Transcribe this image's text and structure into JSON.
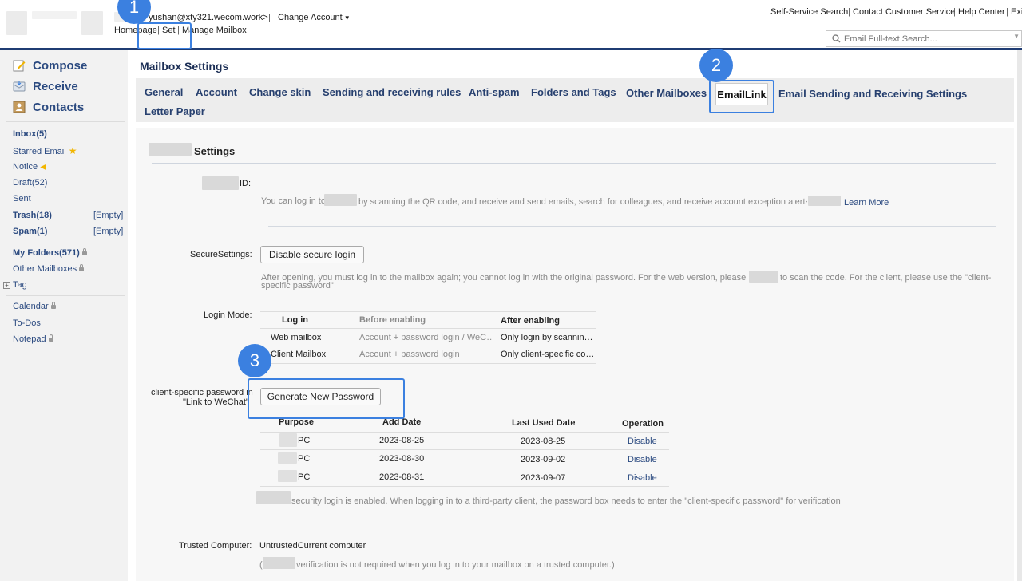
{
  "header": {
    "email": "yushan@xty321.wecom.work>",
    "change_account": "Change Account",
    "nav": [
      "Homepage",
      "Set",
      "Manage Mailbox"
    ],
    "top_links": [
      "Self-Service Search",
      "Contact Customer Service",
      "Help Center",
      "Exi"
    ],
    "search_placeholder": "Email Full-text Search..."
  },
  "sidebar": {
    "compose": "Compose",
    "receive": "Receive",
    "contacts": "Contacts",
    "inbox": "Inbox(5)",
    "starred": "Starred Email",
    "notice": "Notice",
    "draft": "Draft(52)",
    "sent": "Sent",
    "trash": "Trash(18)",
    "spam": "Spam(1)",
    "empty": "[Empty]",
    "my_folders": "My Folders(571)",
    "other_mailboxes": "Other Mailboxes",
    "tag": "Tag",
    "calendar": "Calendar",
    "todos": "To-Dos",
    "notepad": "Notepad"
  },
  "page_title": "Mailbox Settings",
  "tabs": [
    "General",
    "Account",
    "Change skin",
    "Sending and receiving rules",
    "Anti-spam",
    "Folders and Tags",
    "Other Mailboxes",
    "EmailLink",
    "Email Sending and Receiving Settings",
    "Letter Paper"
  ],
  "settings": {
    "section_title": "Settings",
    "id_label": "ID:",
    "id_desc_a": "You can log in to",
    "id_desc_b": "by scanning the QR code, and receive and send emails, search for colleagues, and receive account exception alerts on",
    "learn_more": "Learn More",
    "secure_label": "SecureSettings:",
    "disable_secure_btn": "Disable secure login",
    "secure_desc_a": "After opening, you must log in to the mailbox again; you cannot log in with the original password. For the web version, please use",
    "secure_desc_b": "to scan the code. For the client, please use the \"client-",
    "secure_desc_c": "specific password\"",
    "login_mode_label": "Login Mode:",
    "login_table": {
      "headers": [
        "Log in",
        "Before enabling",
        "After enabling"
      ],
      "rows": [
        [
          "Web mailbox",
          "Account + password login / WeC…",
          "Only login by scannin…"
        ],
        [
          "Client Mailbox",
          "Account + password login",
          "Only client-specific co…"
        ]
      ]
    },
    "csp_label_a": "client-specific password in",
    "csp_label_b": "\"Link to WeChat\"",
    "generate_btn": "Generate New Password",
    "pw_table": {
      "headers": [
        "Purpose",
        "Add Date",
        "Last Used Date",
        "Operation"
      ],
      "rows": [
        {
          "purpose": "PC",
          "add": "2023-08-25",
          "last": "2023-08-25",
          "op": "Disable"
        },
        {
          "purpose": "PC",
          "add": "2023-08-30",
          "last": "2023-09-02",
          "op": "Disable"
        },
        {
          "purpose": "PC",
          "add": "2023-08-31",
          "last": "2023-09-07",
          "op": "Disable"
        }
      ]
    },
    "security_note": "security login is enabled. When logging in to a third-party client, the password box needs to enter the \"client-specific password\" for verification",
    "trusted_label": "Trusted Computer:",
    "trusted_value": "UntrustedCurrent computer",
    "trusted_note_a": "(",
    "trusted_note_b": "verification is not required when you log in to your mailbox on a trusted computer.)"
  },
  "callouts": [
    "1",
    "2",
    "3"
  ],
  "colors": {
    "accent": "#3b80e0",
    "nav_text": "#2b4a80",
    "header_rule": "#1f3c73"
  }
}
